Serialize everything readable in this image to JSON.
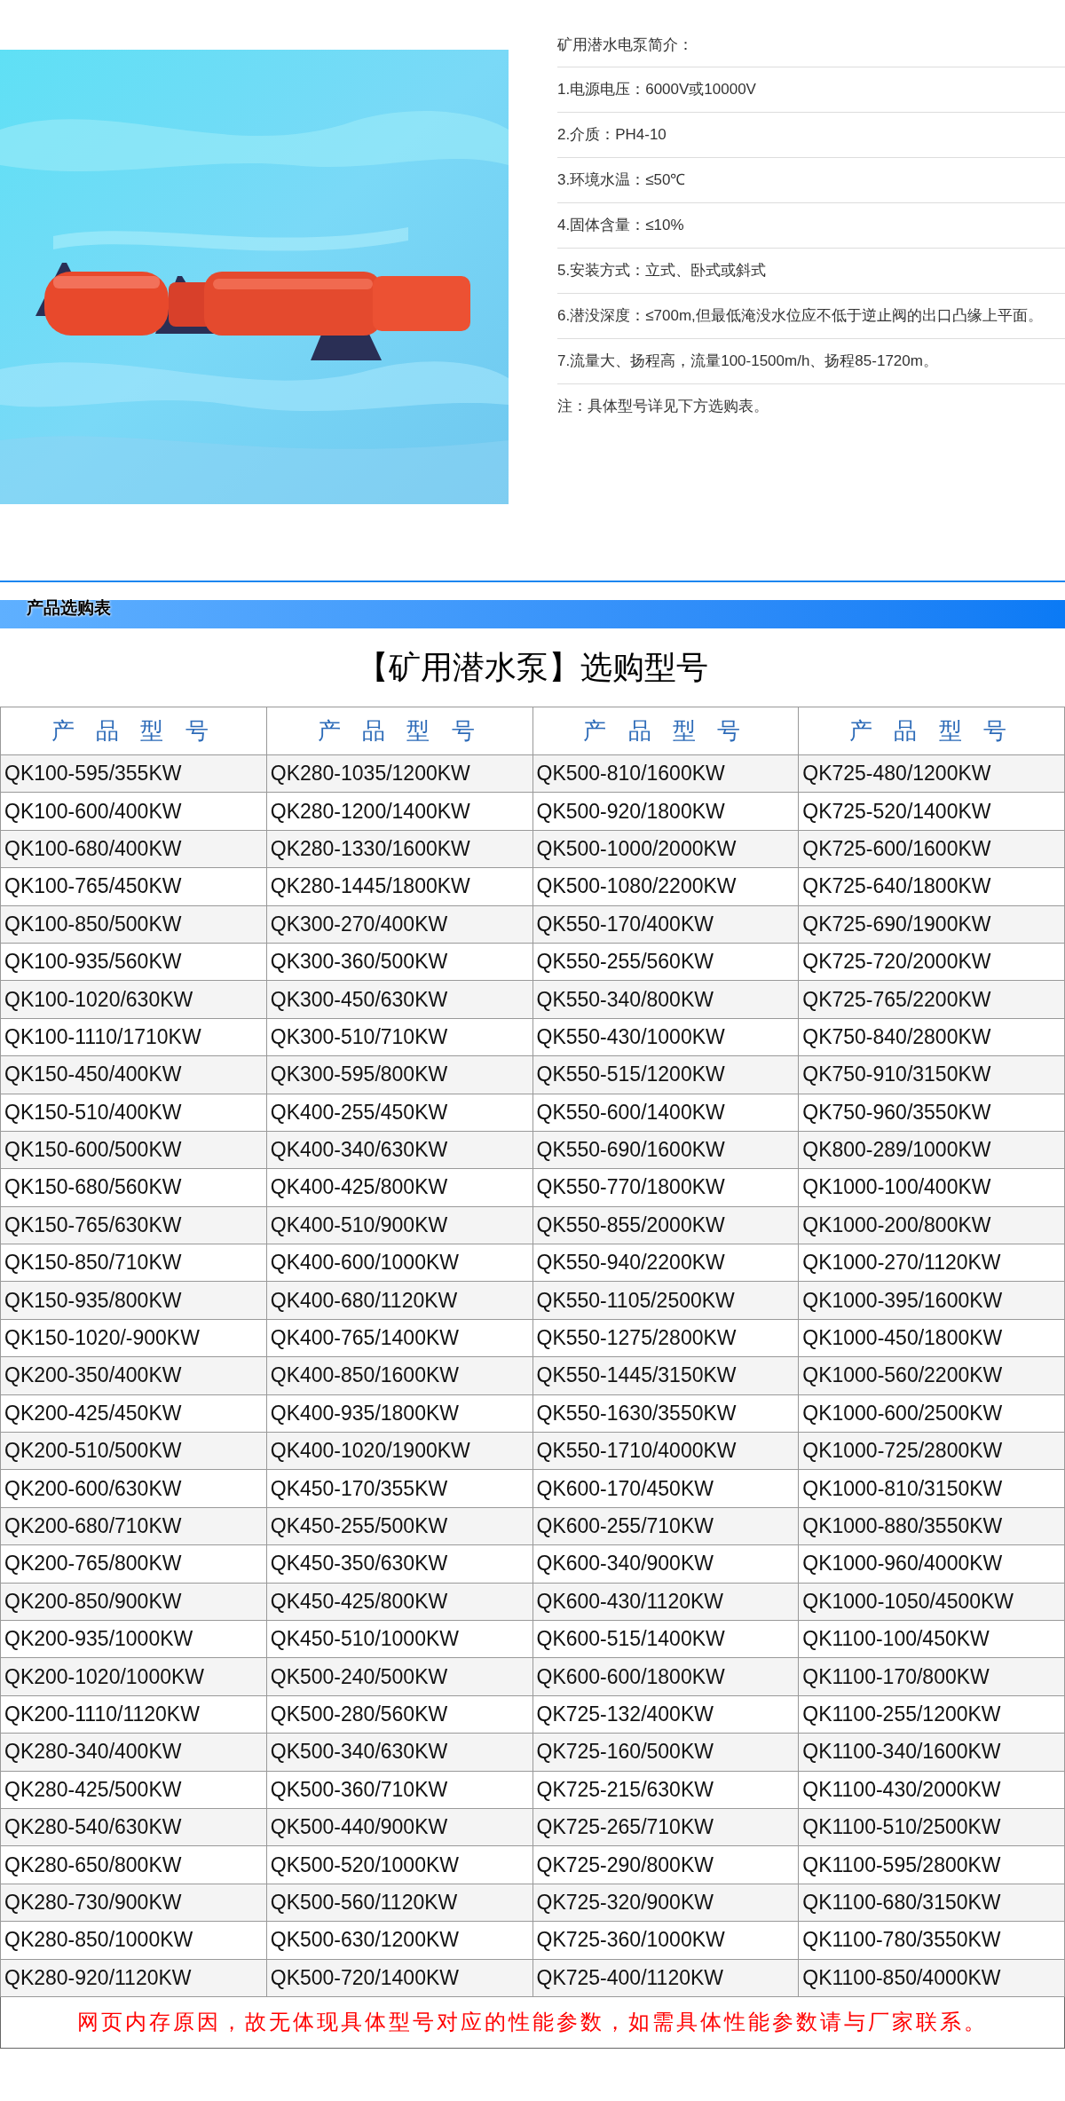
{
  "intro": {
    "title": "矿用潜水电泵简介：",
    "items": [
      {
        "label": "1.电源电压：",
        "value": "6000V或10000V"
      },
      {
        "label": "2.介质：",
        "value": "PH4-10"
      },
      {
        "label": "3.环境水温：",
        "value": "≤50℃"
      },
      {
        "label": "4.固体含量：",
        "value": "≤10%"
      },
      {
        "label": "5.安装方式：",
        "value": "立式、卧式或斜式"
      },
      {
        "label": "6.潜没深度：",
        "value": "≤700m,但最低淹没水位应不低于逆止阀的出口凸缘上平面。"
      },
      {
        "label": "7.",
        "value": "流量大、扬程高，流量100-1500m/h、扬程85-1720m。"
      }
    ],
    "note": "注：具体型号详见下方选购表。"
  },
  "section": {
    "title": "产品选购表"
  },
  "table": {
    "title": "【矿用潜水泵】选购型号",
    "columns": [
      "产 品 型 号",
      "产 品 型 号",
      "产 品 型 号",
      "产 品 型 号"
    ],
    "rows": [
      [
        "QK100-595/355KW",
        "QK280-1035/1200KW",
        "QK500-810/1600KW",
        "QK725-480/1200KW"
      ],
      [
        "QK100-600/400KW",
        "QK280-1200/1400KW",
        "QK500-920/1800KW",
        "QK725-520/1400KW"
      ],
      [
        "QK100-680/400KW",
        "QK280-1330/1600KW",
        "QK500-1000/2000KW",
        "QK725-600/1600KW"
      ],
      [
        "QK100-765/450KW",
        "QK280-1445/1800KW",
        "QK500-1080/2200KW",
        "QK725-640/1800KW"
      ],
      [
        "QK100-850/500KW",
        "QK300-270/400KW",
        "QK550-170/400KW",
        "QK725-690/1900KW"
      ],
      [
        "QK100-935/560KW",
        "QK300-360/500KW",
        "QK550-255/560KW",
        "QK725-720/2000KW"
      ],
      [
        "QK100-1020/630KW",
        "QK300-450/630KW",
        "QK550-340/800KW",
        "QK725-765/2200KW"
      ],
      [
        "QK100-1110/1710KW",
        "QK300-510/710KW",
        "QK550-430/1000KW",
        "QK750-840/2800KW"
      ],
      [
        "QK150-450/400KW",
        "QK300-595/800KW",
        "QK550-515/1200KW",
        "QK750-910/3150KW"
      ],
      [
        "QK150-510/400KW",
        "QK400-255/450KW",
        "QK550-600/1400KW",
        "QK750-960/3550KW"
      ],
      [
        "QK150-600/500KW",
        "QK400-340/630KW",
        "QK550-690/1600KW",
        "QK800-289/1000KW"
      ],
      [
        "QK150-680/560KW",
        "QK400-425/800KW",
        "QK550-770/1800KW",
        "QK1000-100/400KW"
      ],
      [
        "QK150-765/630KW",
        "QK400-510/900KW",
        "QK550-855/2000KW",
        "QK1000-200/800KW"
      ],
      [
        "QK150-850/710KW",
        "QK400-600/1000KW",
        "QK550-940/2200KW",
        "QK1000-270/1120KW"
      ],
      [
        "QK150-935/800KW",
        "QK400-680/1120KW",
        "QK550-1105/2500KW",
        "QK1000-395/1600KW"
      ],
      [
        "QK150-1020/-900KW",
        "QK400-765/1400KW",
        "QK550-1275/2800KW",
        "QK1000-450/1800KW"
      ],
      [
        "QK200-350/400KW",
        "QK400-850/1600KW",
        "QK550-1445/3150KW",
        "QK1000-560/2200KW"
      ],
      [
        "QK200-425/450KW",
        "QK400-935/1800KW",
        "QK550-1630/3550KW",
        "QK1000-600/2500KW"
      ],
      [
        "QK200-510/500KW",
        "QK400-1020/1900KW",
        "QK550-1710/4000KW",
        "QK1000-725/2800KW"
      ],
      [
        "QK200-600/630KW",
        "QK450-170/355KW",
        "QK600-170/450KW",
        "QK1000-810/3150KW"
      ],
      [
        "QK200-680/710KW",
        "QK450-255/500KW",
        "QK600-255/710KW",
        "QK1000-880/3550KW"
      ],
      [
        "QK200-765/800KW",
        "QK450-350/630KW",
        "QK600-340/900KW",
        "QK1000-960/4000KW"
      ],
      [
        "QK200-850/900KW",
        "QK450-425/800KW",
        "QK600-430/1120KW",
        "QK1000-1050/4500KW"
      ],
      [
        "QK200-935/1000KW",
        "QK450-510/1000KW",
        "QK600-515/1400KW",
        "QK1100-100/450KW"
      ],
      [
        "QK200-1020/1000KW",
        "QK500-240/500KW",
        "QK600-600/1800KW",
        "QK1100-170/800KW"
      ],
      [
        "QK200-1110/1120KW",
        "QK500-280/560KW",
        "QK725-132/400KW",
        "QK1100-255/1200KW"
      ],
      [
        "QK280-340/400KW",
        "QK500-340/630KW",
        "QK725-160/500KW",
        "QK1100-340/1600KW"
      ],
      [
        "QK280-425/500KW",
        "QK500-360/710KW",
        "QK725-215/630KW",
        "QK1100-430/2000KW"
      ],
      [
        "QK280-540/630KW",
        "QK500-440/900KW",
        "QK725-265/710KW",
        "QK1100-510/2500KW"
      ],
      [
        "QK280-650/800KW",
        "QK500-520/1000KW",
        "QK725-290/800KW",
        "QK1100-595/2800KW"
      ],
      [
        "QK280-730/900KW",
        "QK500-560/1120KW",
        "QK725-320/900KW",
        "QK1100-680/3150KW"
      ],
      [
        "QK280-850/1000KW",
        "QK500-630/1200KW",
        "QK725-360/1000KW",
        "QK1100-780/3550KW"
      ],
      [
        "QK280-920/1120KW",
        "QK500-720/1400KW",
        "QK725-400/1120KW",
        "QK1100-850/4000KW"
      ]
    ],
    "footer_note": "网页内存原因，故无体现具体型号对应的性能参数，如需具体性能参数请与厂家联系。"
  }
}
